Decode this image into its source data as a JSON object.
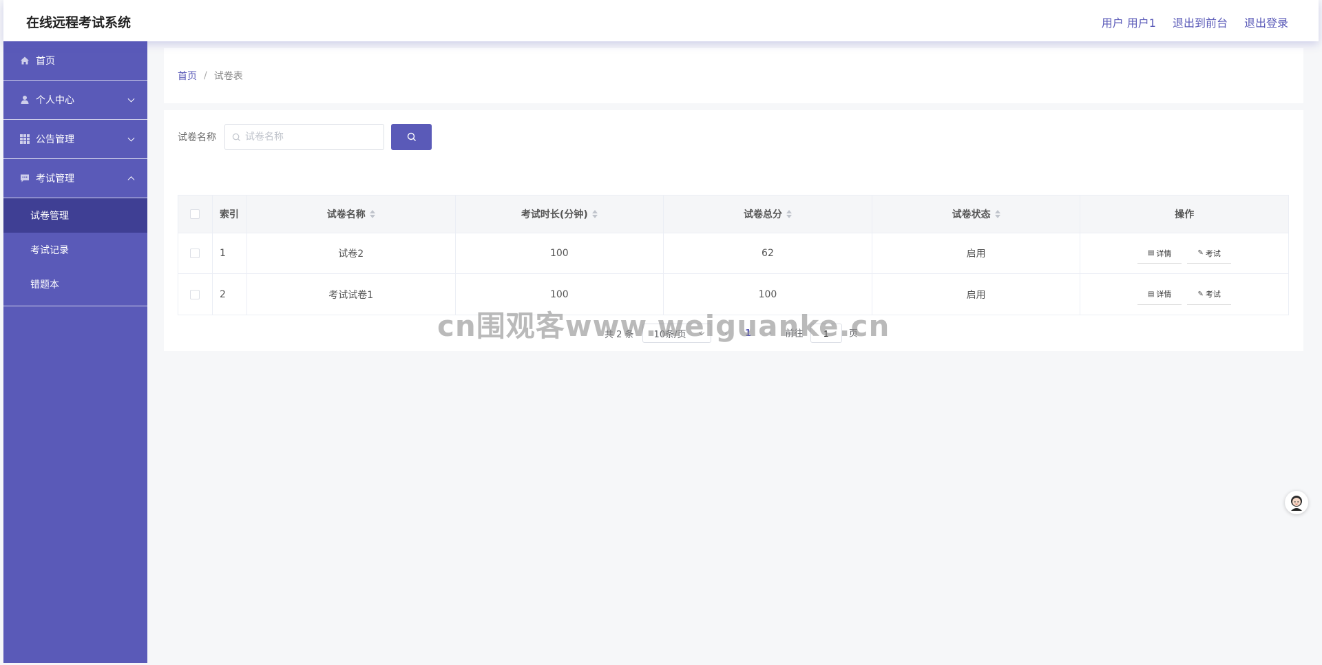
{
  "header": {
    "title": "在线远程考试系统",
    "user_label": "用户 用户1",
    "back_front": "退出到前台",
    "logout": "退出登录"
  },
  "sidebar": {
    "items": [
      {
        "label": "首页",
        "icon": "home-icon"
      },
      {
        "label": "个人中心",
        "icon": "user-icon"
      },
      {
        "label": "公告管理",
        "icon": "grid-icon"
      },
      {
        "label": "考试管理",
        "icon": "message-icon"
      }
    ],
    "sub_items": [
      {
        "label": "试卷管理",
        "active": true
      },
      {
        "label": "考试记录",
        "active": false
      },
      {
        "label": "错题本",
        "active": false
      }
    ]
  },
  "breadcrumb": {
    "home": "首页",
    "separator": "/",
    "current": "试卷表"
  },
  "search": {
    "label": "试卷名称",
    "placeholder": "试卷名称",
    "value": ""
  },
  "table": {
    "columns": [
      "索引",
      "试卷名称",
      "考试时长(分钟)",
      "试卷总分",
      "试卷状态",
      "操作"
    ],
    "rows": [
      {
        "index": "1",
        "name": "试卷2",
        "duration": "100",
        "score": "62",
        "status": "启用"
      },
      {
        "index": "2",
        "name": "考试试卷1",
        "duration": "100",
        "score": "100",
        "status": "启用"
      }
    ],
    "op_detail": "详情",
    "op_exam": "考试"
  },
  "pagination": {
    "total_text": "共 2 条",
    "page_size": "10条/页",
    "current_page": "1",
    "goto_label": "前往",
    "goto_value": "1",
    "page_suffix": "页"
  },
  "watermark": "cn围观客www.weiguanke.cn",
  "colors": {
    "accent": "#5a5ab8",
    "sidebar_active": "#3f3f94"
  }
}
